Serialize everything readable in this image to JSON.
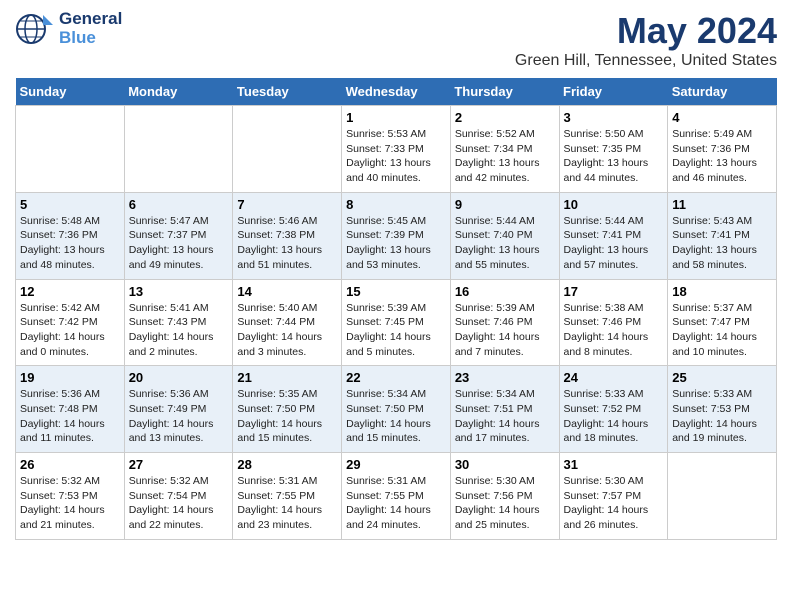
{
  "logo": {
    "line1": "General",
    "line2": "Blue"
  },
  "title": "May 2024",
  "subtitle": "Green Hill, Tennessee, United States",
  "days_of_week": [
    "Sunday",
    "Monday",
    "Tuesday",
    "Wednesday",
    "Thursday",
    "Friday",
    "Saturday"
  ],
  "weeks": [
    [
      {
        "day": "",
        "info": ""
      },
      {
        "day": "",
        "info": ""
      },
      {
        "day": "",
        "info": ""
      },
      {
        "day": "1",
        "info": "Sunrise: 5:53 AM\nSunset: 7:33 PM\nDaylight: 13 hours\nand 40 minutes."
      },
      {
        "day": "2",
        "info": "Sunrise: 5:52 AM\nSunset: 7:34 PM\nDaylight: 13 hours\nand 42 minutes."
      },
      {
        "day": "3",
        "info": "Sunrise: 5:50 AM\nSunset: 7:35 PM\nDaylight: 13 hours\nand 44 minutes."
      },
      {
        "day": "4",
        "info": "Sunrise: 5:49 AM\nSunset: 7:36 PM\nDaylight: 13 hours\nand 46 minutes."
      }
    ],
    [
      {
        "day": "5",
        "info": "Sunrise: 5:48 AM\nSunset: 7:36 PM\nDaylight: 13 hours\nand 48 minutes."
      },
      {
        "day": "6",
        "info": "Sunrise: 5:47 AM\nSunset: 7:37 PM\nDaylight: 13 hours\nand 49 minutes."
      },
      {
        "day": "7",
        "info": "Sunrise: 5:46 AM\nSunset: 7:38 PM\nDaylight: 13 hours\nand 51 minutes."
      },
      {
        "day": "8",
        "info": "Sunrise: 5:45 AM\nSunset: 7:39 PM\nDaylight: 13 hours\nand 53 minutes."
      },
      {
        "day": "9",
        "info": "Sunrise: 5:44 AM\nSunset: 7:40 PM\nDaylight: 13 hours\nand 55 minutes."
      },
      {
        "day": "10",
        "info": "Sunrise: 5:44 AM\nSunset: 7:41 PM\nDaylight: 13 hours\nand 57 minutes."
      },
      {
        "day": "11",
        "info": "Sunrise: 5:43 AM\nSunset: 7:41 PM\nDaylight: 13 hours\nand 58 minutes."
      }
    ],
    [
      {
        "day": "12",
        "info": "Sunrise: 5:42 AM\nSunset: 7:42 PM\nDaylight: 14 hours\nand 0 minutes."
      },
      {
        "day": "13",
        "info": "Sunrise: 5:41 AM\nSunset: 7:43 PM\nDaylight: 14 hours\nand 2 minutes."
      },
      {
        "day": "14",
        "info": "Sunrise: 5:40 AM\nSunset: 7:44 PM\nDaylight: 14 hours\nand 3 minutes."
      },
      {
        "day": "15",
        "info": "Sunrise: 5:39 AM\nSunset: 7:45 PM\nDaylight: 14 hours\nand 5 minutes."
      },
      {
        "day": "16",
        "info": "Sunrise: 5:39 AM\nSunset: 7:46 PM\nDaylight: 14 hours\nand 7 minutes."
      },
      {
        "day": "17",
        "info": "Sunrise: 5:38 AM\nSunset: 7:46 PM\nDaylight: 14 hours\nand 8 minutes."
      },
      {
        "day": "18",
        "info": "Sunrise: 5:37 AM\nSunset: 7:47 PM\nDaylight: 14 hours\nand 10 minutes."
      }
    ],
    [
      {
        "day": "19",
        "info": "Sunrise: 5:36 AM\nSunset: 7:48 PM\nDaylight: 14 hours\nand 11 minutes."
      },
      {
        "day": "20",
        "info": "Sunrise: 5:36 AM\nSunset: 7:49 PM\nDaylight: 14 hours\nand 13 minutes."
      },
      {
        "day": "21",
        "info": "Sunrise: 5:35 AM\nSunset: 7:50 PM\nDaylight: 14 hours\nand 15 minutes."
      },
      {
        "day": "22",
        "info": "Sunrise: 5:34 AM\nSunset: 7:50 PM\nDaylight: 14 hours\nand 15 minutes."
      },
      {
        "day": "23",
        "info": "Sunrise: 5:34 AM\nSunset: 7:51 PM\nDaylight: 14 hours\nand 17 minutes."
      },
      {
        "day": "24",
        "info": "Sunrise: 5:33 AM\nSunset: 7:52 PM\nDaylight: 14 hours\nand 18 minutes."
      },
      {
        "day": "25",
        "info": "Sunrise: 5:33 AM\nSunset: 7:53 PM\nDaylight: 14 hours\nand 19 minutes."
      }
    ],
    [
      {
        "day": "26",
        "info": "Sunrise: 5:32 AM\nSunset: 7:53 PM\nDaylight: 14 hours\nand 21 minutes."
      },
      {
        "day": "27",
        "info": "Sunrise: 5:32 AM\nSunset: 7:54 PM\nDaylight: 14 hours\nand 22 minutes."
      },
      {
        "day": "28",
        "info": "Sunrise: 5:31 AM\nSunset: 7:55 PM\nDaylight: 14 hours\nand 23 minutes."
      },
      {
        "day": "29",
        "info": "Sunrise: 5:31 AM\nSunset: 7:55 PM\nDaylight: 14 hours\nand 24 minutes."
      },
      {
        "day": "30",
        "info": "Sunrise: 5:30 AM\nSunset: 7:56 PM\nDaylight: 14 hours\nand 25 minutes."
      },
      {
        "day": "31",
        "info": "Sunrise: 5:30 AM\nSunset: 7:57 PM\nDaylight: 14 hours\nand 26 minutes."
      },
      {
        "day": "",
        "info": ""
      }
    ]
  ]
}
